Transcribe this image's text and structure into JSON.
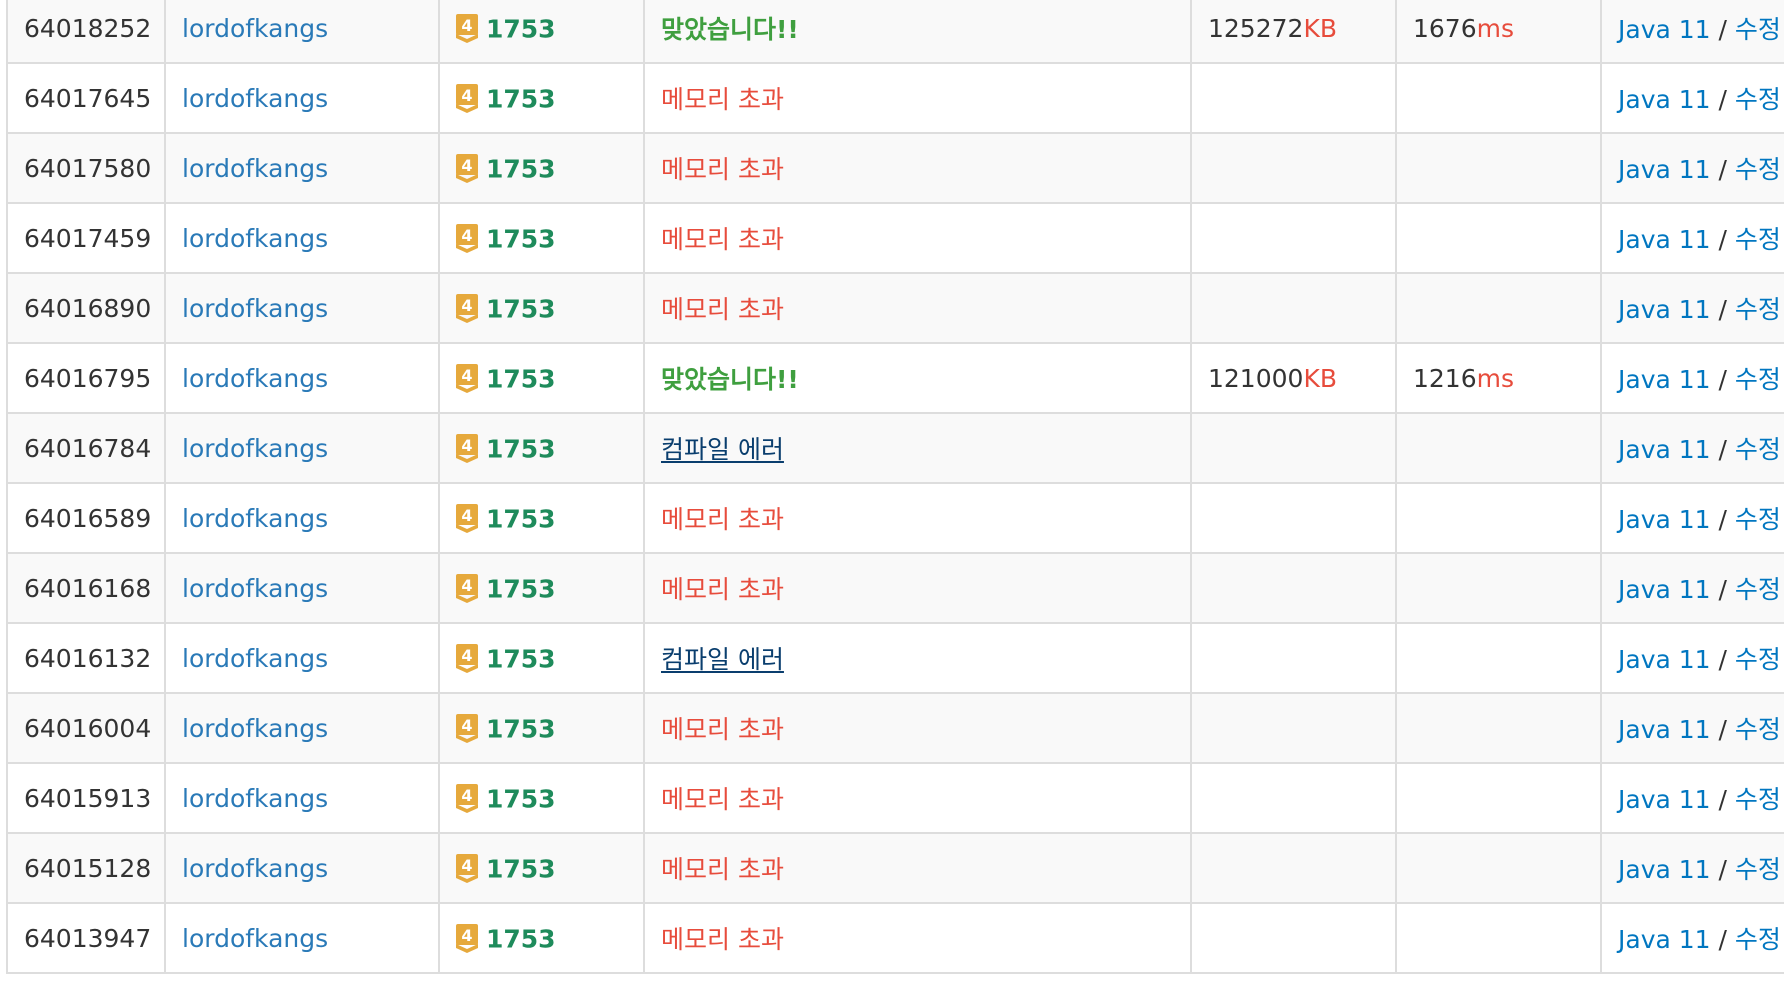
{
  "colors": {
    "link": "#0076c0",
    "problem": "#1e8b5b",
    "accepted": "#3f9f3f",
    "memory_exceeded": "#e74c3c",
    "compile_error": "#0a3e6e",
    "tier_gold": "#e6a93c"
  },
  "icons": {
    "tier": "gold-tier-4-icon"
  },
  "rows": [
    {
      "id": "64018252",
      "user": "lordofkangs",
      "tier": "4",
      "problem": "1753",
      "result": "맞았습니다!!",
      "result_type": "ac",
      "memory": "125272",
      "memory_unit": "KB",
      "time": "1676",
      "time_unit": "ms",
      "lang": "Java 11",
      "sep": " / ",
      "edit": "수정"
    },
    {
      "id": "64017645",
      "user": "lordofkangs",
      "tier": "4",
      "problem": "1753",
      "result": "메모리 초과",
      "result_type": "mle",
      "memory": "",
      "memory_unit": "",
      "time": "",
      "time_unit": "",
      "lang": "Java 11",
      "sep": " / ",
      "edit": "수정"
    },
    {
      "id": "64017580",
      "user": "lordofkangs",
      "tier": "4",
      "problem": "1753",
      "result": "메모리 초과",
      "result_type": "mle",
      "memory": "",
      "memory_unit": "",
      "time": "",
      "time_unit": "",
      "lang": "Java 11",
      "sep": " / ",
      "edit": "수정"
    },
    {
      "id": "64017459",
      "user": "lordofkangs",
      "tier": "4",
      "problem": "1753",
      "result": "메모리 초과",
      "result_type": "mle",
      "memory": "",
      "memory_unit": "",
      "time": "",
      "time_unit": "",
      "lang": "Java 11",
      "sep": " / ",
      "edit": "수정"
    },
    {
      "id": "64016890",
      "user": "lordofkangs",
      "tier": "4",
      "problem": "1753",
      "result": "메모리 초과",
      "result_type": "mle",
      "memory": "",
      "memory_unit": "",
      "time": "",
      "time_unit": "",
      "lang": "Java 11",
      "sep": " / ",
      "edit": "수정"
    },
    {
      "id": "64016795",
      "user": "lordofkangs",
      "tier": "4",
      "problem": "1753",
      "result": "맞았습니다!!",
      "result_type": "ac",
      "memory": "121000",
      "memory_unit": "KB",
      "time": "1216",
      "time_unit": "ms",
      "lang": "Java 11",
      "sep": " / ",
      "edit": "수정"
    },
    {
      "id": "64016784",
      "user": "lordofkangs",
      "tier": "4",
      "problem": "1753",
      "result": "컴파일 에러",
      "result_type": "ce",
      "memory": "",
      "memory_unit": "",
      "time": "",
      "time_unit": "",
      "lang": "Java 11",
      "sep": " / ",
      "edit": "수정"
    },
    {
      "id": "64016589",
      "user": "lordofkangs",
      "tier": "4",
      "problem": "1753",
      "result": "메모리 초과",
      "result_type": "mle",
      "memory": "",
      "memory_unit": "",
      "time": "",
      "time_unit": "",
      "lang": "Java 11",
      "sep": " / ",
      "edit": "수정"
    },
    {
      "id": "64016168",
      "user": "lordofkangs",
      "tier": "4",
      "problem": "1753",
      "result": "메모리 초과",
      "result_type": "mle",
      "memory": "",
      "memory_unit": "",
      "time": "",
      "time_unit": "",
      "lang": "Java 11",
      "sep": " / ",
      "edit": "수정"
    },
    {
      "id": "64016132",
      "user": "lordofkangs",
      "tier": "4",
      "problem": "1753",
      "result": "컴파일 에러",
      "result_type": "ce",
      "memory": "",
      "memory_unit": "",
      "time": "",
      "time_unit": "",
      "lang": "Java 11",
      "sep": " / ",
      "edit": "수정"
    },
    {
      "id": "64016004",
      "user": "lordofkangs",
      "tier": "4",
      "problem": "1753",
      "result": "메모리 초과",
      "result_type": "mle",
      "memory": "",
      "memory_unit": "",
      "time": "",
      "time_unit": "",
      "lang": "Java 11",
      "sep": " / ",
      "edit": "수정"
    },
    {
      "id": "64015913",
      "user": "lordofkangs",
      "tier": "4",
      "problem": "1753",
      "result": "메모리 초과",
      "result_type": "mle",
      "memory": "",
      "memory_unit": "",
      "time": "",
      "time_unit": "",
      "lang": "Java 11",
      "sep": " / ",
      "edit": "수정"
    },
    {
      "id": "64015128",
      "user": "lordofkangs",
      "tier": "4",
      "problem": "1753",
      "result": "메모리 초과",
      "result_type": "mle",
      "memory": "",
      "memory_unit": "",
      "time": "",
      "time_unit": "",
      "lang": "Java 11",
      "sep": " / ",
      "edit": "수정"
    },
    {
      "id": "64013947",
      "user": "lordofkangs",
      "tier": "4",
      "problem": "1753",
      "result": "메모리 초과",
      "result_type": "mle",
      "memory": "",
      "memory_unit": "",
      "time": "",
      "time_unit": "",
      "lang": "Java 11",
      "sep": " / ",
      "edit": "수정"
    }
  ]
}
